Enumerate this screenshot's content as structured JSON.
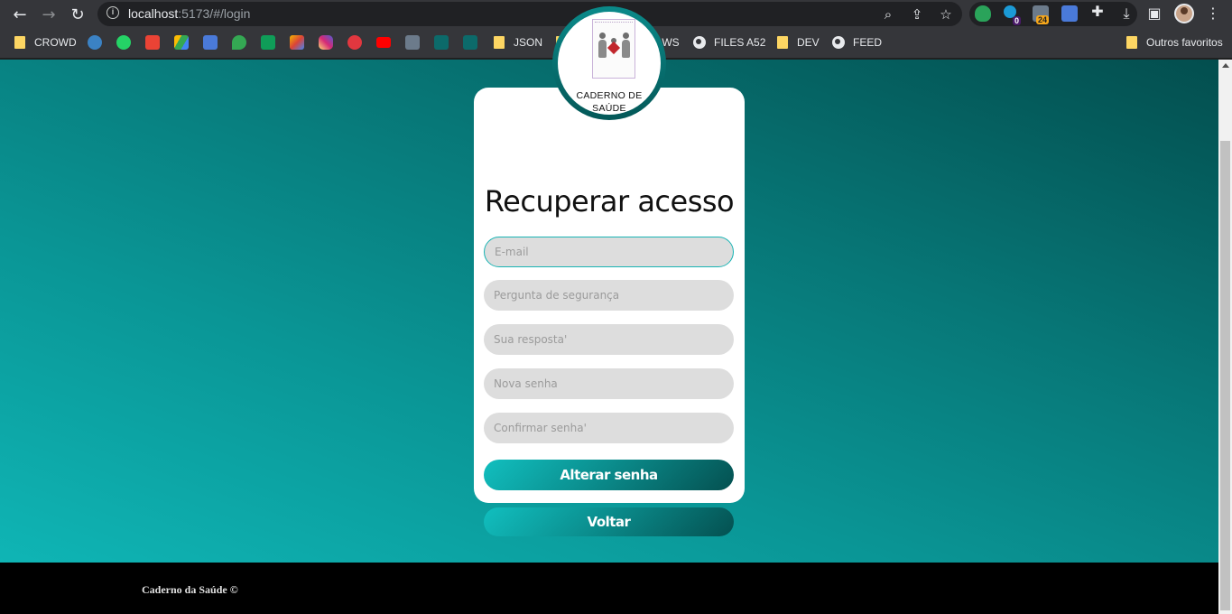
{
  "browser": {
    "url_host": "localhost",
    "url_rest": ":5173/#/login",
    "ext_badge_1": "0",
    "ext_badge_2": "24"
  },
  "bookmarks": {
    "items": [
      {
        "label": "CROWD",
        "type": "folder"
      },
      {
        "label": "JSON",
        "type": "folder"
      },
      {
        "label": "TV",
        "type": "folder"
      },
      {
        "label": "WINDOWS",
        "type": "folder"
      },
      {
        "label": "FILES A52",
        "type": "globe"
      },
      {
        "label": "DEV",
        "type": "folder"
      },
      {
        "label": "FEED",
        "type": "globe"
      }
    ],
    "other": "Outros favoritos"
  },
  "logo": {
    "line1": "CADERNO DE",
    "line2": "SAÚDE"
  },
  "form": {
    "title": "Recuperar acesso",
    "email_placeholder": "E-mail",
    "question_placeholder": "Pergunta de segurança",
    "answer_placeholder": "Sua resposta'",
    "new_password_placeholder": "Nova senha",
    "confirm_password_placeholder": "Confirmar senha'",
    "submit_label": "Alterar senha",
    "back_label": "Voltar"
  },
  "footer": {
    "text": "Caderno da Saúde ©"
  },
  "colors": {
    "accent": "#0fb5b5",
    "dark_teal": "#034e4e",
    "field_bg": "#dddddd"
  }
}
